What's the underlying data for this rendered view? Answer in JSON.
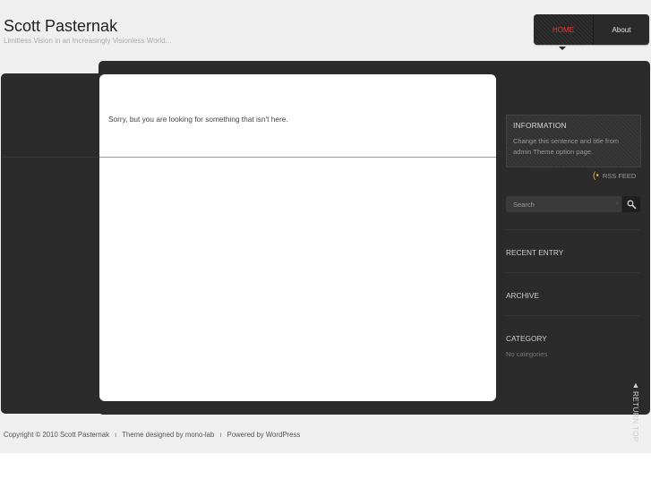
{
  "site": {
    "title": "Scott Pasternak",
    "tagline": "Limitless Vision in an Increasingly Visionless World..."
  },
  "nav": {
    "items": [
      {
        "label": "HOME",
        "active": true
      },
      {
        "label": "About",
        "active": false
      }
    ]
  },
  "content": {
    "message": "Sorry, but you are looking for something that isn't here."
  },
  "sidebar": {
    "information": {
      "title": "INFORMATION",
      "text": "Change this sentence and title from admin Theme option page."
    },
    "rss_label": "RSS FEED",
    "search": {
      "placeholder": "Search"
    },
    "recent_entry": "RECENT ENTRY",
    "archive": "ARCHIVE",
    "category": "CATEGORY",
    "category_note": "No categories"
  },
  "return_top": "RETURN TOP",
  "footer": {
    "copyright": "Copyright ©  2010  Scott Pasternak",
    "separator": "ı",
    "designed": "Theme designed by mono-lab",
    "powered": "Powered by WordPress"
  },
  "colors": {
    "accent": "#e03a3a",
    "rss": "#e0b030",
    "dark_panel": "#2b2b2b"
  }
}
